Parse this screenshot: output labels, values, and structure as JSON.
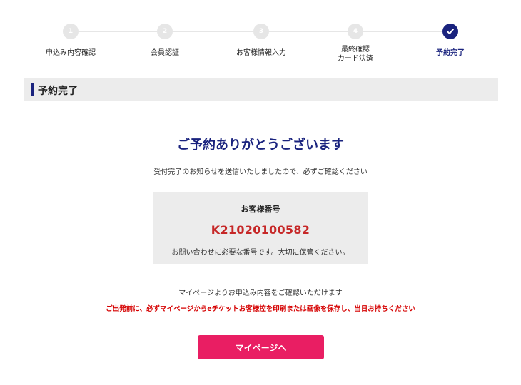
{
  "steps": [
    {
      "number": "1",
      "label": "申込み内容確認"
    },
    {
      "number": "2",
      "label": "会員認証"
    },
    {
      "number": "3",
      "label": "お客様情報入力"
    },
    {
      "number": "4",
      "label_line1": "最終確認",
      "label_line2": "カード決済"
    },
    {
      "label": "予約完了",
      "icon": "checkmark-icon",
      "state": "active"
    }
  ],
  "section": {
    "title": "予約完了"
  },
  "confirmation": {
    "heading": "ご予約ありがとうございます",
    "message": "受付完了のお知らせを送信いたしましたので、必ずご確認ください"
  },
  "customer_number": {
    "label": "お客様番号",
    "value": "K21020100582",
    "note": "お問い合わせに必要な番号です。大切に保管ください。"
  },
  "mypage_note": "マイページよりお申込み内容をご確認いただけます",
  "warning": "ご出発前に、必ずマイページからeチケットお客様控を印刷または画像を保存し、当日お持ちください",
  "button": {
    "label": "マイページへ"
  },
  "colors": {
    "accent": "#1a237e",
    "number": "#c62828",
    "warning": "#d50000",
    "button": "#e91e63",
    "inactive_step": "#e6e6e6"
  }
}
